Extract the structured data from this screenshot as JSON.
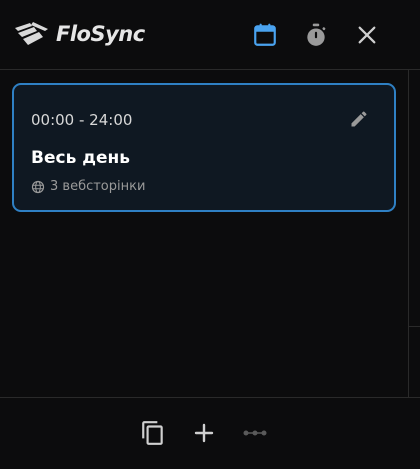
{
  "app": {
    "name": "FloSync",
    "logo_icon": "flosync-logo-icon"
  },
  "header": {
    "buttons": [
      {
        "icon": "calendar-icon",
        "active": true
      },
      {
        "icon": "stopwatch-icon",
        "active": false
      },
      {
        "icon": "close-icon",
        "active": false
      }
    ]
  },
  "schedule": {
    "items": [
      {
        "time_range": "00:00 - 24:00",
        "title": "Весь день",
        "sites_label": "3 вебсторінки",
        "edit_icon": "pencil-icon",
        "globe_icon": "globe-icon"
      }
    ]
  },
  "footer": {
    "buttons": [
      {
        "icon": "copy-icon"
      },
      {
        "icon": "plus-icon"
      },
      {
        "icon": "more-horizontal-icon",
        "disabled": true
      }
    ]
  },
  "colors": {
    "background": "#0c0c0d",
    "accent": "#2f80c4",
    "accent_bright": "#4aa3ef",
    "card_background": "#0f1822",
    "icon_muted": "#9a9a9a",
    "icon_disabled": "#5a5a5a",
    "divider": "#2a2a2a"
  }
}
